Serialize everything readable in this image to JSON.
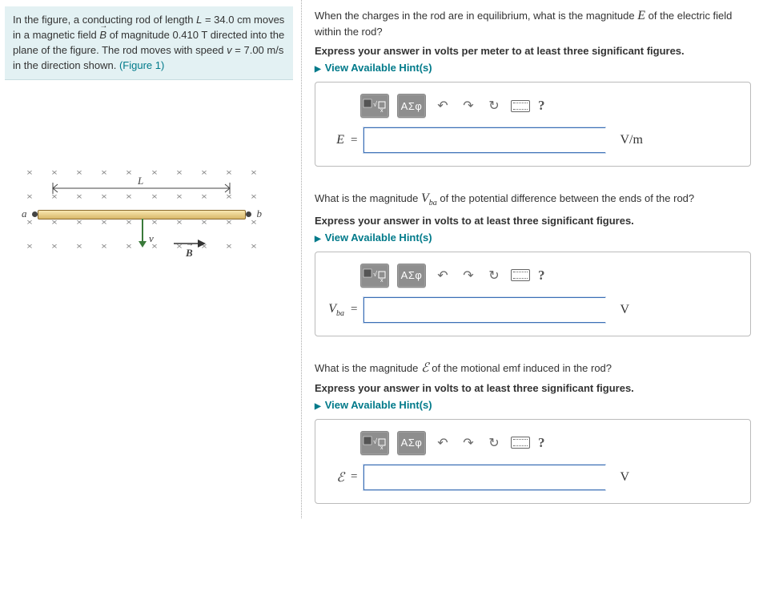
{
  "problem": {
    "text1": "In the figure, a conducting rod of length ",
    "L_sym": "L",
    "L_eq": " = 34.0 cm",
    "text2": " moves in a magnetic field ",
    "B_sym": "B",
    "B_eq": " of magnitude 0.410 T",
    "text3": " directed into the plane of the figure. The rod moves with speed ",
    "v_sym": "v",
    "v_eq": " = 7.00 m/s",
    "text4": " in the direction shown. ",
    "figlink": "(Figure 1)"
  },
  "figure": {
    "a": "a",
    "b": "b",
    "L": "L",
    "v": "v",
    "B": "B"
  },
  "parts": [
    {
      "question_pre": "When the charges in the rod are in equilibrium, what is the magnitude ",
      "sym": "E",
      "question_post": " of the electric field within the rod?",
      "instruct": "Express your answer in volts per meter to at least three significant figures.",
      "hints": "View Available Hint(s)",
      "var": "E",
      "unit": "V/m"
    },
    {
      "question_pre": "What is the magnitude ",
      "sym": "V",
      "sym_sub": "ba",
      "question_post": " of the potential difference between the ends of the rod?",
      "instruct": "Express your answer in volts to at least three significant figures.",
      "hints": "View Available Hint(s)",
      "var": "V",
      "var_sub": "ba",
      "unit": "V"
    },
    {
      "question_pre": "What is the magnitude ",
      "sym": "ℰ",
      "question_post": " of the motional emf induced in the rod?",
      "instruct": "Express your answer in volts to at least three significant figures.",
      "hints": "View Available Hint(s)",
      "var": "ℰ",
      "unit": "V"
    }
  ],
  "toolbar": {
    "template": "x",
    "sigma": "ΑΣφ",
    "undo": "↶",
    "redo": "↷",
    "reset": "↻",
    "help": "?"
  }
}
